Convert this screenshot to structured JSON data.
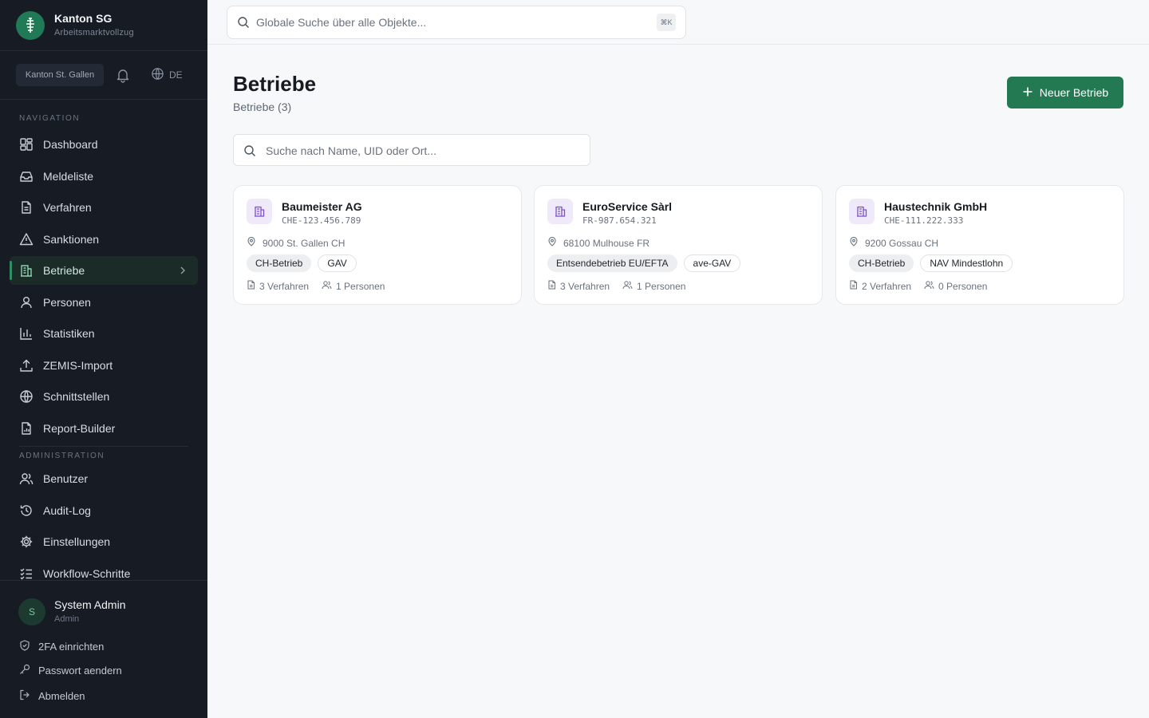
{
  "brand": {
    "title": "Kanton SG",
    "subtitle": "Arbeitsmarktvollzug"
  },
  "toolbar": {
    "canton": "Kanton St. Gallen",
    "language": "DE"
  },
  "nav": {
    "section_label": "NAVIGATION",
    "items": [
      {
        "label": "Dashboard",
        "icon": "dashboard-icon"
      },
      {
        "label": "Meldeliste",
        "icon": "inbox-icon"
      },
      {
        "label": "Verfahren",
        "icon": "document-icon"
      },
      {
        "label": "Sanktionen",
        "icon": "warning-icon"
      },
      {
        "label": "Betriebe",
        "icon": "building-icon",
        "active": true
      },
      {
        "label": "Personen",
        "icon": "person-icon"
      },
      {
        "label": "Statistiken",
        "icon": "bar-chart-icon"
      },
      {
        "label": "ZEMIS-Import",
        "icon": "upload-icon"
      },
      {
        "label": "Schnittstellen",
        "icon": "globe-icon"
      },
      {
        "label": "Report-Builder",
        "icon": "report-icon"
      }
    ]
  },
  "admin": {
    "section_label": "ADMINISTRATION",
    "items": [
      {
        "label": "Benutzer",
        "icon": "users-icon"
      },
      {
        "label": "Audit-Log",
        "icon": "history-icon"
      },
      {
        "label": "Einstellungen",
        "icon": "gear-icon"
      },
      {
        "label": "Workflow-Schritte",
        "icon": "checklist-icon"
      }
    ]
  },
  "user": {
    "initial": "S",
    "name": "System Admin",
    "role": "Admin",
    "links": [
      {
        "label": "2FA einrichten",
        "icon": "shield-check-icon"
      },
      {
        "label": "Passwort aendern",
        "icon": "key-icon"
      },
      {
        "label": "Abmelden",
        "icon": "logout-icon"
      }
    ]
  },
  "topbar": {
    "search_placeholder": "Globale Suche über alle Objekte...",
    "shortcut": "⌘K"
  },
  "page": {
    "title": "Betriebe",
    "subtitle": "Betriebe (3)",
    "new_button": "Neuer Betrieb",
    "search_placeholder": "Suche nach Name, UID oder Ort..."
  },
  "companies": [
    {
      "name": "Baumeister AG",
      "uid": "CHE-123.456.789",
      "location": "9000 St. Gallen CH",
      "tags": [
        "CH-Betrieb",
        "GAV"
      ],
      "verfahren": "3 Verfahren",
      "personen": "1 Personen"
    },
    {
      "name": "EuroService Sàrl",
      "uid": "FR-987.654.321",
      "location": "68100 Mulhouse FR",
      "tags": [
        "Entsendebetrieb EU/EFTA",
        "ave-GAV"
      ],
      "verfahren": "3 Verfahren",
      "personen": "1 Personen"
    },
    {
      "name": "Haustechnik GmbH",
      "uid": "CHE-111.222.333",
      "location": "9200 Gossau CH",
      "tags": [
        "CH-Betrieb",
        "NAV Mindestlohn"
      ],
      "verfahren": "2 Verfahren",
      "personen": "0 Personen"
    }
  ],
  "colors": {
    "sidebar_bg": "#161b24",
    "accent_green": "#237a52",
    "building_tint": "#7b4fd0"
  }
}
